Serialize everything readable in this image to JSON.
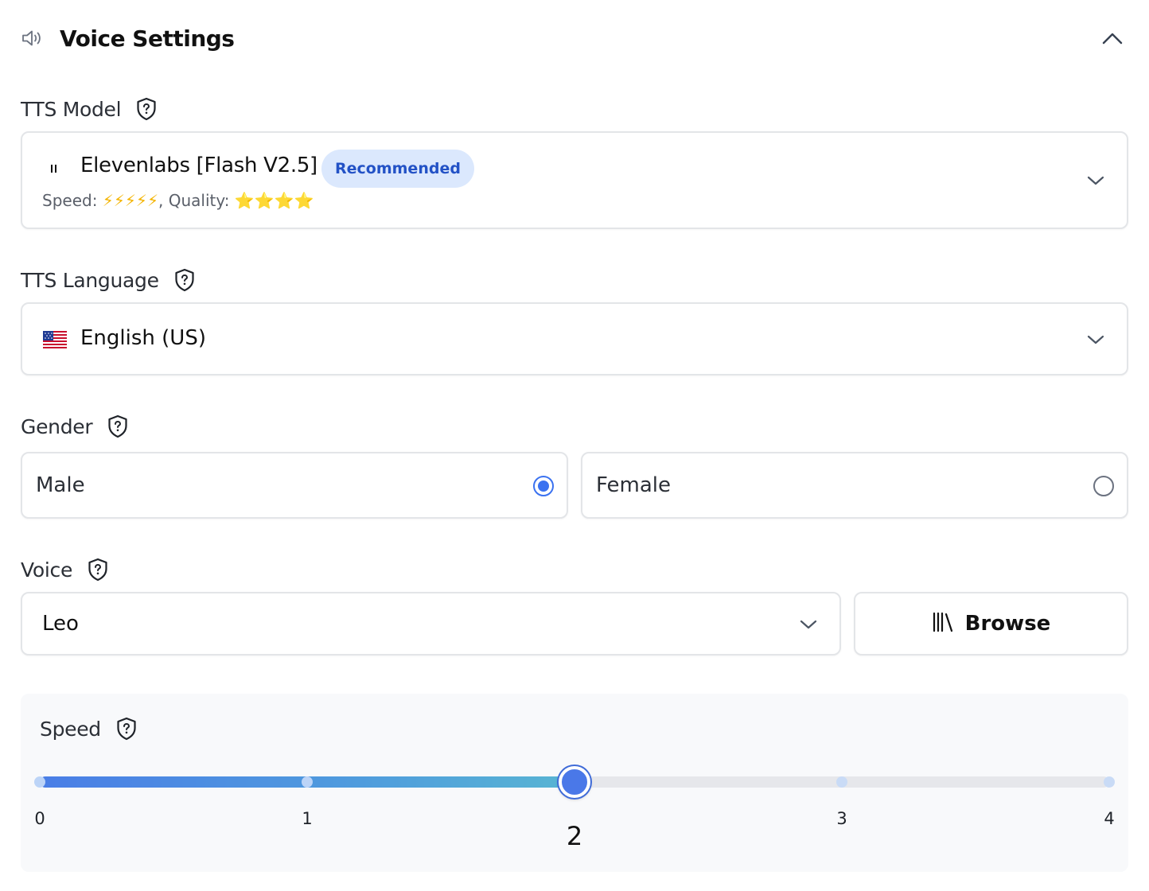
{
  "header": {
    "title": "Voice Settings",
    "icon": "speaker-icon",
    "collapse_icon": "chevron-up-icon"
  },
  "tts_model": {
    "label": "TTS Model",
    "selected_name": "Elevenlabs [Flash V2.5]",
    "badge": "Recommended",
    "rating_speed_label": "Speed:",
    "rating_speed_glyphs": "⚡⚡⚡⚡⚡",
    "rating_sep": ", Quality:",
    "rating_quality_glyphs": "⭐⭐⭐⭐"
  },
  "tts_language": {
    "label": "TTS Language",
    "selected": "English (US)",
    "flag": "us-flag-icon"
  },
  "gender": {
    "label": "Gender",
    "options": [
      {
        "label": "Male",
        "selected": true
      },
      {
        "label": "Female",
        "selected": false
      }
    ]
  },
  "voice": {
    "label": "Voice",
    "selected": "Leo",
    "browse_label": "Browse"
  },
  "speed": {
    "label": "Speed",
    "min": 0,
    "max": 4,
    "value": 2,
    "value_text": "2",
    "ticks": [
      "0",
      "1",
      "3",
      "4"
    ],
    "tick_values": [
      0,
      1,
      3,
      4
    ]
  },
  "colors": {
    "accent": "#3b72f0",
    "badge_bg": "#dbe8fd",
    "badge_text": "#2352c6"
  }
}
